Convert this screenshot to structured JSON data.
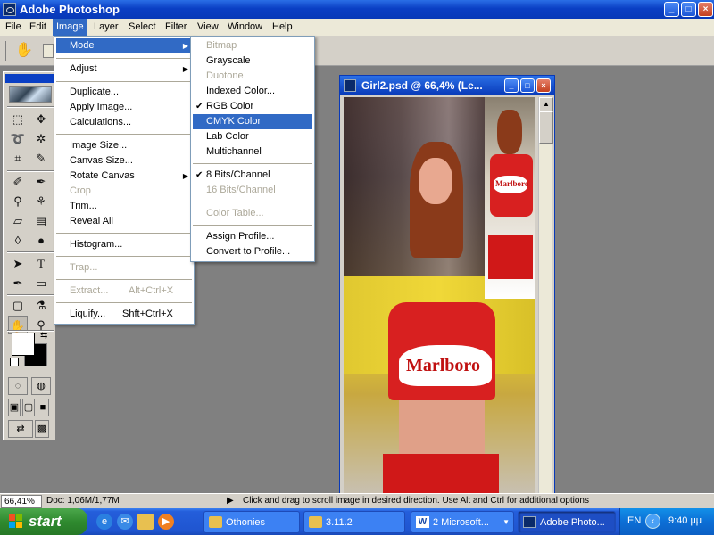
{
  "window": {
    "title": "Adobe Photoshop",
    "controls": [
      "_",
      "□",
      "×"
    ]
  },
  "menubar": [
    "File",
    "Edit",
    "Image",
    "Layer",
    "Select",
    "Filter",
    "View",
    "Window",
    "Help"
  ],
  "image_menu": {
    "items": [
      {
        "label": "Mode",
        "submenu": true,
        "highlighted": true
      },
      {
        "label": "Adjust",
        "submenu": true
      },
      {
        "label": "Duplicate..."
      },
      {
        "label": "Apply Image..."
      },
      {
        "label": "Calculations..."
      },
      {
        "label": "Image Size..."
      },
      {
        "label": "Canvas Size..."
      },
      {
        "label": "Rotate Canvas",
        "submenu": true
      },
      {
        "label": "Crop",
        "disabled": true
      },
      {
        "label": "Trim..."
      },
      {
        "label": "Reveal All"
      },
      {
        "label": "Histogram..."
      },
      {
        "label": "Trap...",
        "disabled": true
      },
      {
        "label": "Extract...",
        "shortcut": "Alt+Ctrl+X",
        "disabled": true
      },
      {
        "label": "Liquify...",
        "shortcut": "Shft+Ctrl+X"
      }
    ]
  },
  "mode_menu": {
    "items": [
      {
        "label": "Bitmap",
        "disabled": true
      },
      {
        "label": "Grayscale"
      },
      {
        "label": "Duotone",
        "disabled": true
      },
      {
        "label": "Indexed Color..."
      },
      {
        "label": "RGB Color",
        "checked": true
      },
      {
        "label": "CMYK Color",
        "highlighted": true
      },
      {
        "label": "Lab Color"
      },
      {
        "label": "Multichannel"
      },
      {
        "label": "8 Bits/Channel",
        "checked": true
      },
      {
        "label": "16 Bits/Channel",
        "disabled": true
      },
      {
        "label": "Color Table...",
        "disabled": true
      },
      {
        "label": "Assign Profile..."
      },
      {
        "label": "Convert to Profile..."
      }
    ]
  },
  "document": {
    "title": "Girl2.psd @ 66,4% (Le...",
    "image_text": "Marlboro"
  },
  "statusbar": {
    "zoom": "66,41%",
    "doc": "Doc: 1,06M/1,77M",
    "hint": "Click and drag to scroll image in desired direction.  Use Alt and Ctrl for additional options"
  },
  "taskbar": {
    "start": "start",
    "tasks": [
      {
        "label": "Othonies",
        "icon": "folder-icon"
      },
      {
        "label": "3.11.2",
        "icon": "folder-icon"
      },
      {
        "label": "2 Microsoft...",
        "icon": "word-icon",
        "grouped": true
      },
      {
        "label": "Adobe Photo...",
        "icon": "photoshop-icon",
        "active": true
      }
    ],
    "tray": {
      "lang": "EN",
      "clock": "9:40 μμ"
    }
  },
  "colors": {
    "highlight": "#316ac5",
    "menu_bg": "#ffffff",
    "disabled_text": "#aca899",
    "titlebar": "#0a3fc4"
  }
}
